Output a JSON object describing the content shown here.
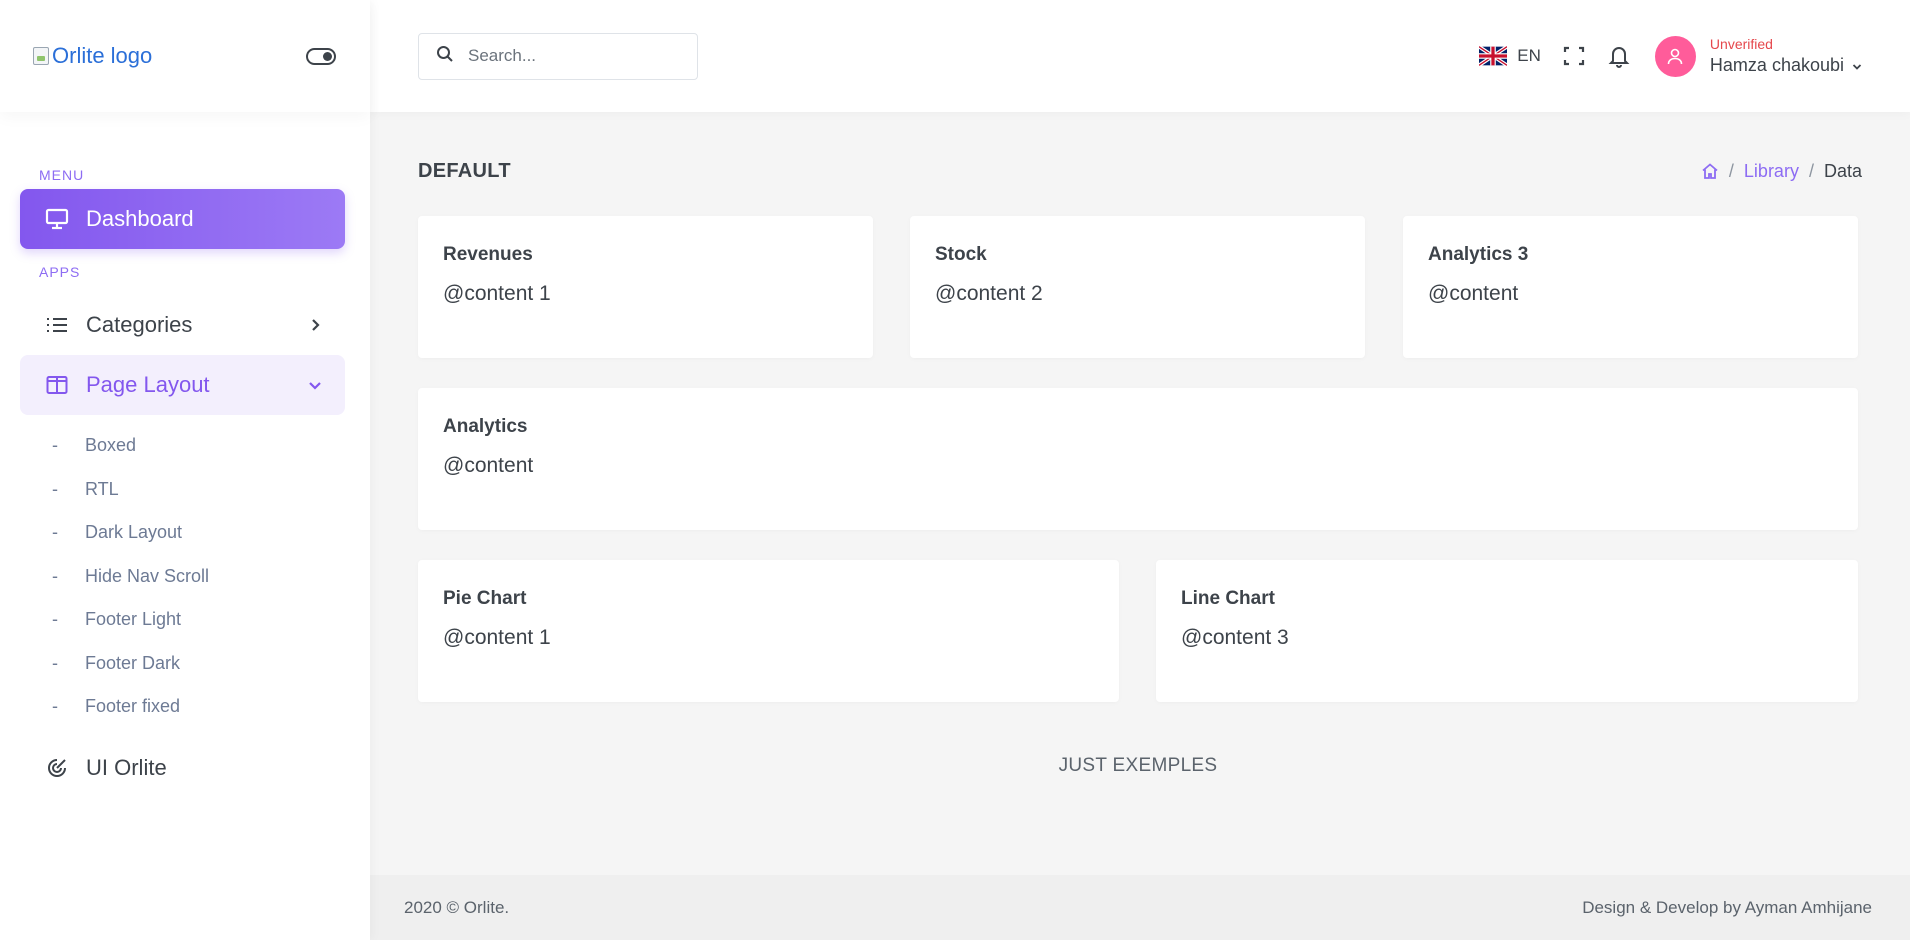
{
  "sidebar": {
    "logo_alt": "Orlite logo",
    "sections": {
      "menu": "MENU",
      "apps": "APPS"
    },
    "dashboard": {
      "label": "Dashboard",
      "icon": "monitor-icon"
    },
    "categories": {
      "label": "Categories",
      "icon": "list-icon"
    },
    "page_layout": {
      "label": "Page Layout",
      "icon": "layout-icon",
      "items": [
        "Boxed",
        "RTL",
        "Dark Layout",
        "Hide Nav Scroll",
        "Footer Light",
        "Footer Dark",
        "Footer fixed"
      ]
    },
    "ui_orlite": {
      "label": "UI Orlite",
      "icon": "radar-icon"
    },
    "bullet": "-"
  },
  "header": {
    "search_placeholder": "Search...",
    "language": "EN",
    "user": {
      "status": "Unverified",
      "name": "Hamza chakoubi"
    }
  },
  "main": {
    "page_title": "DEFAULT",
    "breadcrumb": {
      "library": "Library",
      "sep": "/",
      "current": "Data"
    },
    "cards": [
      {
        "title": "Revenues",
        "content": "@content 1"
      },
      {
        "title": "Stock",
        "content": "@content 2"
      },
      {
        "title": "Analytics 3",
        "content": "@content"
      },
      {
        "title": "Analytics",
        "content": "@content"
      },
      {
        "title": "Pie Chart",
        "content": "@content 1"
      },
      {
        "title": "Line Chart",
        "content": "@content 3"
      }
    ],
    "note": "JUST EXEMPLES"
  },
  "footer": {
    "copyright": "2020 © Orlite.",
    "credit": "Design & Develop by Ayman Amhijane"
  },
  "colors": {
    "accent": "#8357ee",
    "accent_light": "#f3effd",
    "avatar": "#ff5c9a",
    "unverified": "#e5484d"
  }
}
